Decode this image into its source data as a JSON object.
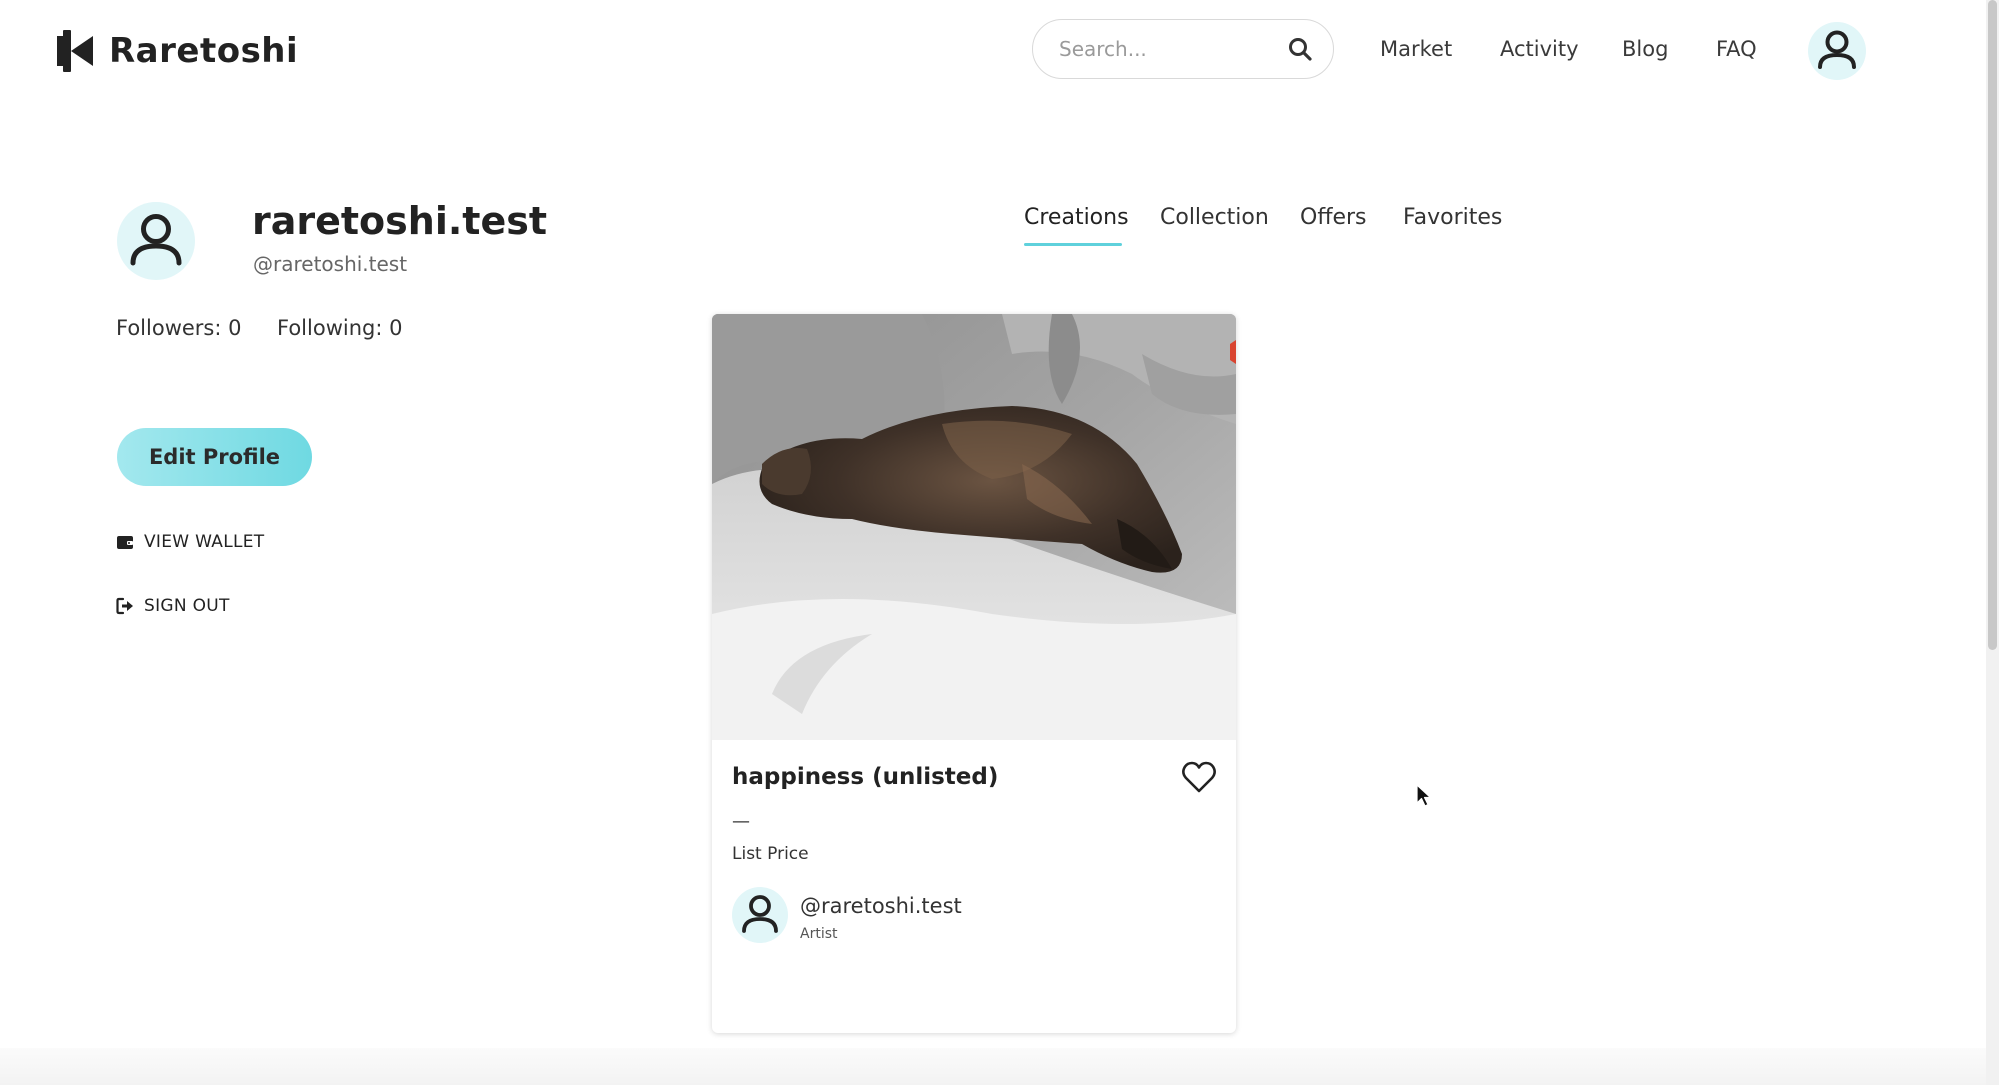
{
  "header": {
    "logo_text": "Raretoshi",
    "search": {
      "placeholder": "Search..."
    },
    "nav": {
      "market": "Market",
      "activity": "Activity",
      "blog": "Blog",
      "faq": "FAQ"
    }
  },
  "profile": {
    "name": "raretoshi.test",
    "handle": "@raretoshi.test",
    "followers_label": "Followers: 0",
    "following_label": "Following: 0",
    "edit_button": "Edit Profile",
    "view_wallet": "VIEW WALLET",
    "sign_out": "SIGN OUT"
  },
  "tabs": {
    "creations": "Creations",
    "collection": "Collection",
    "offers": "Offers",
    "favorites": "Favorites",
    "active": "Creations"
  },
  "card": {
    "title": "happiness (unlisted)",
    "price_value": "—",
    "price_label": "List Price",
    "artist_handle": "@raretoshi.test",
    "artist_role": "Artist"
  },
  "colors": {
    "accent": "#5fd1dc",
    "button_gradient_start": "#a3e8ee",
    "button_gradient_end": "#6fd9e2",
    "avatar_bg": "#e1f6f8"
  },
  "icons": {
    "logo": "raretoshi-logo-icon",
    "search": "search-icon",
    "avatar": "user-avatar-icon",
    "wallet": "wallet-icon",
    "sign_out": "sign-out-icon",
    "favorite": "heart-icon"
  }
}
